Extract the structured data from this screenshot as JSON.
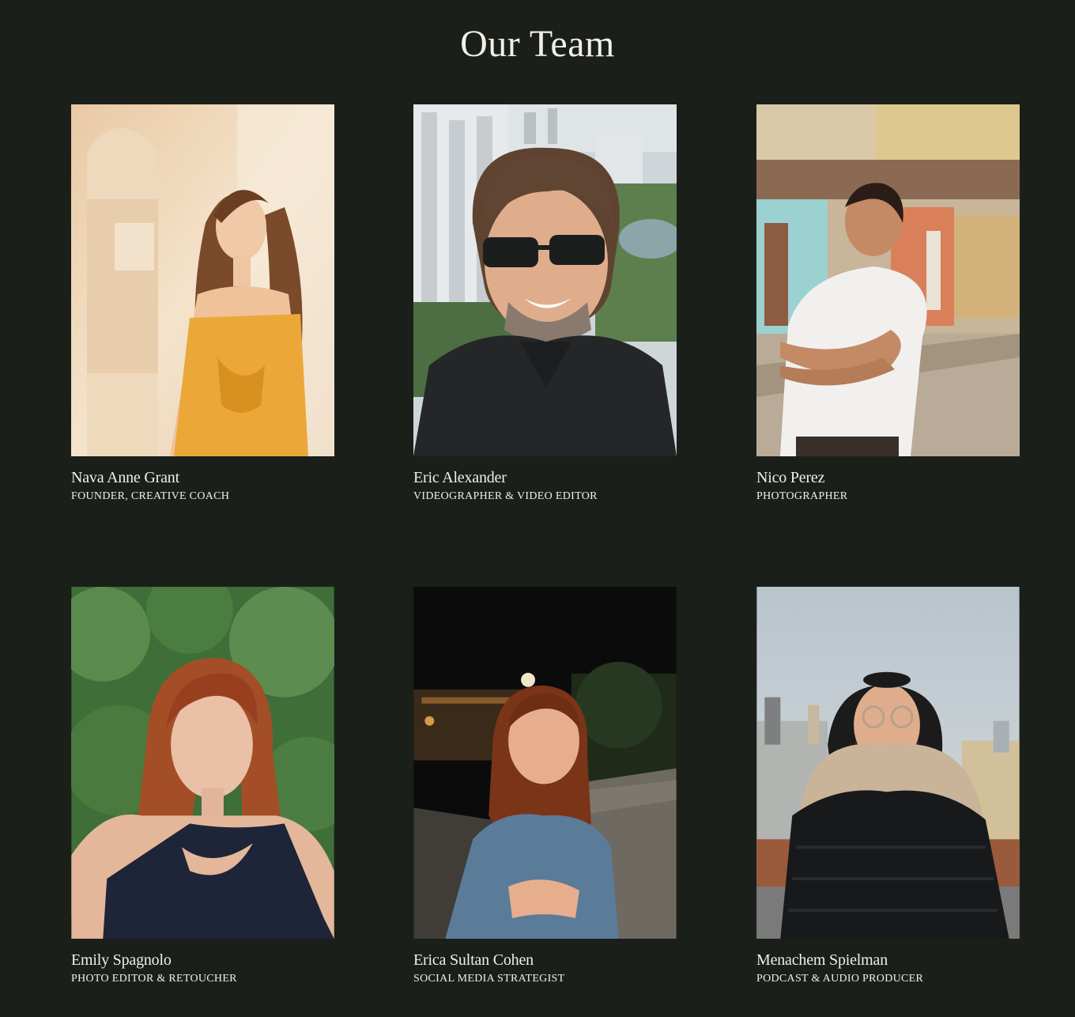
{
  "page": {
    "title": "Our Team",
    "background": "#1b1f1a",
    "text_color": "#f2efe6"
  },
  "team": [
    {
      "name": "Nava Anne Grant",
      "role": "FOUNDER, CREATIVE COACH"
    },
    {
      "name": "Eric Alexander",
      "role": "VIDEOGRAPHER & VIDEO EDITOR"
    },
    {
      "name": "Nico Perez",
      "role": "PHOTOGRAPHER"
    },
    {
      "name": "Emily Spagnolo",
      "role": "PHOTO EDITOR & RETOUCHER"
    },
    {
      "name": "Erica Sultan Cohen",
      "role": "SOCIAL MEDIA STRATEGIST"
    },
    {
      "name": "Menachem Spielman",
      "role": "PODCAST & AUDIO PRODUCER"
    }
  ]
}
